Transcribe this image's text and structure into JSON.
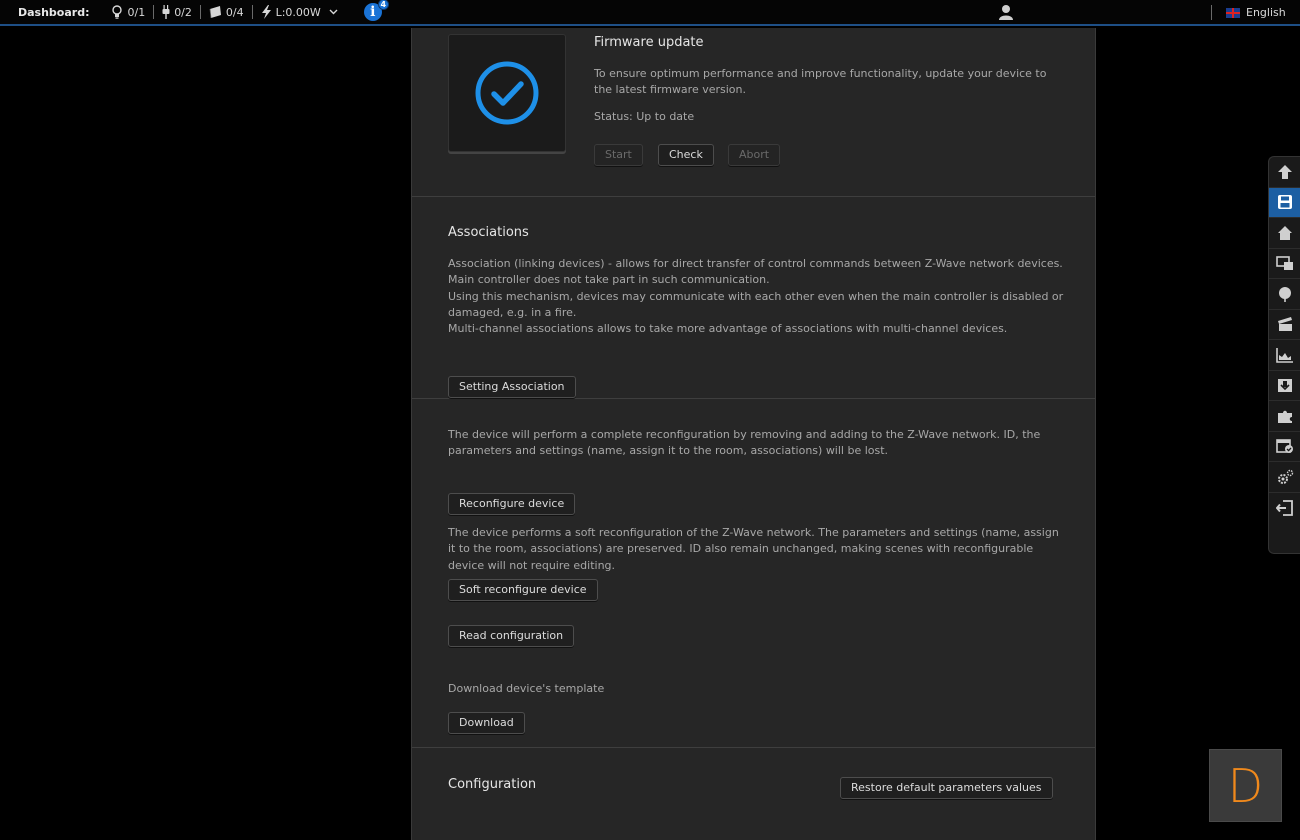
{
  "topbar": {
    "dashboard_label": "Dashboard:",
    "lights": "0/1",
    "sockets": "0/2",
    "blinds": "0/4",
    "power": "L:0.00W",
    "info_count": "4",
    "language": "English"
  },
  "firmware": {
    "title": "Firmware update",
    "description": "To ensure optimum performance and improve functionality, update your device to the latest firmware version.",
    "status": "Status: Up to date",
    "start_label": "Start",
    "check_label": "Check",
    "abort_label": "Abort"
  },
  "associations": {
    "title": "Associations",
    "lines": [
      "Association (linking devices) - allows for direct transfer of control commands between Z-Wave network devices.",
      "Main controller does not take part in such communication.",
      "Using this mechanism, devices may communicate with each other even when the main controller is disabled or damaged, e.g. in a fire.",
      "Multi-channel associations allows to take more advantage of associations with multi-channel devices."
    ],
    "button_label": "Setting Association"
  },
  "reconfigure": {
    "description": "The device will perform a complete reconfiguration by removing and adding to the Z-Wave network. ID, the parameters and settings (name, assign it to the room, associations) will be lost.",
    "button_label": "Reconfigure device",
    "soft_description": "The device performs a soft reconfiguration of the Z-Wave network. The parameters and settings (name, assign it to the room, associations) are preserved. ID also remain unchanged, making scenes with reconfigurable device will not require editing.",
    "soft_button_label": "Soft reconfigure device",
    "read_button_label": "Read configuration",
    "template_text": "Download device's template",
    "download_label": "Download"
  },
  "configuration": {
    "title": "Configuration",
    "restore_label": "Restore default parameters values"
  },
  "widget": {
    "letter": "D"
  }
}
